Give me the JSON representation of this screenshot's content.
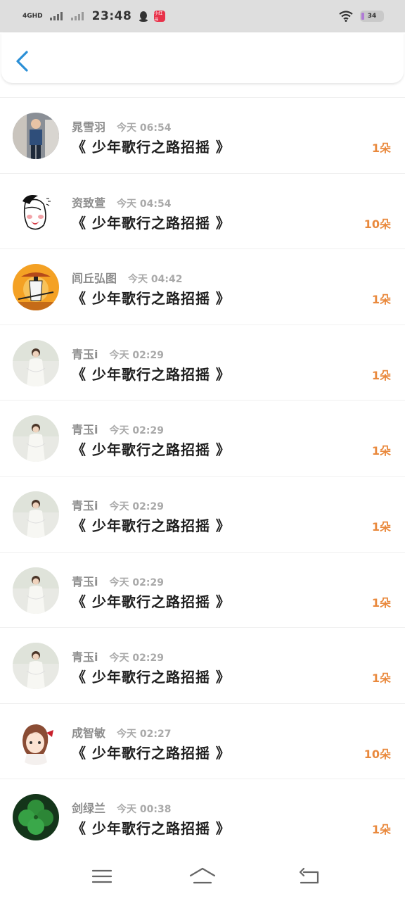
{
  "status_bar": {
    "network": "4GHD",
    "time": "23:48",
    "app_badge": "小红书",
    "battery": "34"
  },
  "header": {
    "back_icon": "chevron-left-icon",
    "accent_color": "#2b8fd6"
  },
  "list": [
    {
      "name": "晁雪羽",
      "time": "今天 06:54",
      "title": "《 少年歌行之路招摇 》",
      "count": "1朵",
      "avatar": "photo-man"
    },
    {
      "name": "资致萱",
      "time": "今天 04:54",
      "title": "《 少年歌行之路招摇 》",
      "count": "10朵",
      "avatar": "sketch-face"
    },
    {
      "name": "闾丘弘图",
      "time": "今天 04:42",
      "title": "《 少年歌行之路招摇 》",
      "count": "1朵",
      "avatar": "samurai-sunset"
    },
    {
      "name": "青玉i",
      "time": "今天 02:29",
      "title": "《 少年歌行之路招摇 》",
      "count": "1朵",
      "avatar": "bride"
    },
    {
      "name": "青玉i",
      "time": "今天 02:29",
      "title": "《 少年歌行之路招摇 》",
      "count": "1朵",
      "avatar": "bride"
    },
    {
      "name": "青玉i",
      "time": "今天 02:29",
      "title": "《 少年歌行之路招摇 》",
      "count": "1朵",
      "avatar": "bride"
    },
    {
      "name": "青玉i",
      "time": "今天 02:29",
      "title": "《 少年歌行之路招摇 》",
      "count": "1朵",
      "avatar": "bride"
    },
    {
      "name": "青玉i",
      "time": "今天 02:29",
      "title": "《 少年歌行之路招摇 》",
      "count": "1朵",
      "avatar": "bride"
    },
    {
      "name": "成智敏",
      "time": "今天 02:27",
      "title": "《 少年歌行之路招摇 》",
      "count": "10朵",
      "avatar": "anime-girl"
    },
    {
      "name": "剑绿兰",
      "time": "今天 00:38",
      "title": "《 少年歌行之路招摇 》",
      "count": "1朵",
      "avatar": "clover"
    }
  ],
  "colors": {
    "count": "#e9893d",
    "name": "#8d8d8d",
    "title": "#1e1e1e"
  },
  "nav_bar": {
    "icons": [
      "menu-icon",
      "home-icon",
      "back-icon"
    ]
  }
}
